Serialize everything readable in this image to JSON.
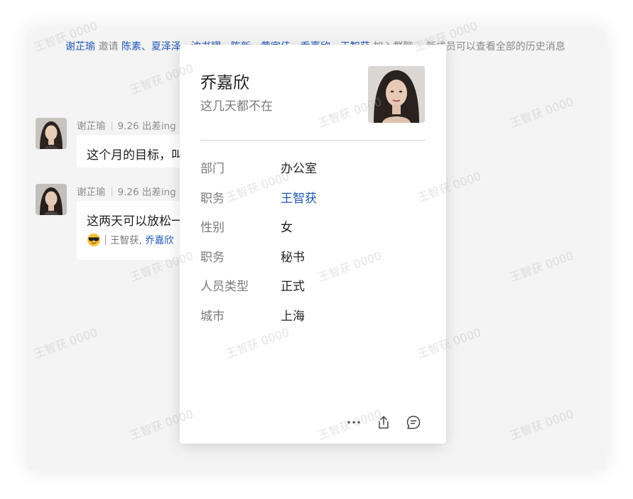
{
  "system_message": {
    "inviter": "谢芷瑜",
    "verb": "邀请",
    "invitees": "陈素、夏泽泽、沈书耀、陈新、黄宇佳、乔嘉欣、王智获",
    "action": "加入群聊，",
    "note": "新成员可以查看全部的历史消息"
  },
  "messages": [
    {
      "sender": "谢芷瑜",
      "note": "9.26 出差ing",
      "text": "这个月的目标，叫"
    },
    {
      "sender": "谢芷瑜",
      "note": "9.26 出差ing",
      "text": "这两天可以放松一",
      "reaction": {
        "emoji": "sunglasses-emoji",
        "users": "王智获,",
        "users_link": "乔嘉欣"
      }
    }
  ],
  "watermark": "王智获 0000",
  "profile_card": {
    "name": "乔嘉欣",
    "status": "这几天都不在",
    "fields": [
      {
        "label": "部门",
        "value": "办公室"
      },
      {
        "label": "职务",
        "value": "王智获"
      },
      {
        "label": "性别",
        "value": "女"
      },
      {
        "label": "职务",
        "value": "秘书"
      },
      {
        "label": "人员类型",
        "value": "正式"
      },
      {
        "label": "城市",
        "value": "上海"
      }
    ],
    "actions": [
      "more-icon",
      "share-icon",
      "chat-icon"
    ]
  },
  "colors": {
    "link": "#1f57b5",
    "chat_bg": "#f4f4f5",
    "card_bg": "#ffffff"
  }
}
